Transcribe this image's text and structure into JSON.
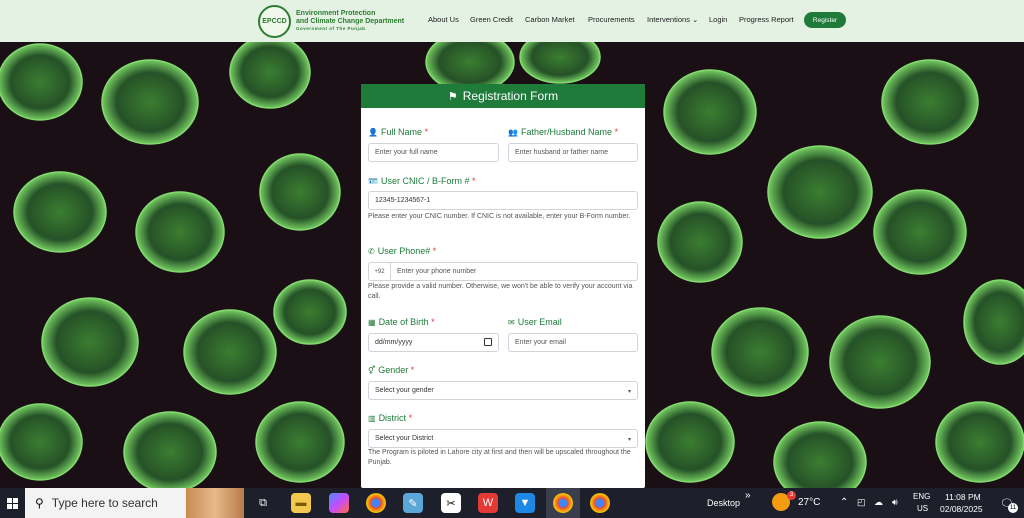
{
  "header": {
    "logo_badge": "EPCCD",
    "org_line1": "Environment Protection",
    "org_line2": "and Climate Change Department",
    "org_sub": "Government of The Punjab",
    "nav": [
      "About Us",
      "Green Credit",
      "Carbon Market",
      "Procurements",
      "Interventions ⌄",
      "Login",
      "Progress Report"
    ],
    "register_label": "Register"
  },
  "form": {
    "title": "Registration Form",
    "full_name_label": "Full Name",
    "full_name_placeholder": "Enter your full name",
    "father_label": "Father/Husband Name",
    "father_placeholder": "Enter husband or father name",
    "cnic_label": "User CNIC / B-Form #",
    "cnic_value": "12345-1234567-1",
    "cnic_help": "Please enter your CNIC number. If CNIC is not available, enter your B-Form number.",
    "phone_label": "User Phone#",
    "phone_prefix": "+92",
    "phone_placeholder": "Enter your phone number",
    "phone_help": "Please provide a valid number. Otherwise, we won't be able to verify your account via call.",
    "dob_label": "Date of Birth",
    "dob_value": "dd/mm/yyyy",
    "email_label": "User Email",
    "email_placeholder": "Enter your email",
    "gender_label": "Gender",
    "gender_selected": "Select your gender",
    "district_label": "District",
    "district_selected": "Select your District",
    "district_help": "The Program is piloted in Lahore city at first and then will be upscaled throughout the Punjab.",
    "required_mark": "*"
  },
  "taskbar": {
    "search_placeholder": "Type here to search",
    "desktop_label": "Desktop",
    "chevron": "»",
    "weather_temp": "27°C",
    "lang_line1": "ENG",
    "lang_line2": "US",
    "time": "11:08 PM",
    "date": "02/08/2025",
    "notification_count": "11",
    "weather_badge": "3"
  },
  "colors": {
    "brand_green": "#1e7b3a",
    "header_bg": "#e3f2e3",
    "required_red": "#e53935",
    "taskbar_bg": "#1d1f2b"
  }
}
